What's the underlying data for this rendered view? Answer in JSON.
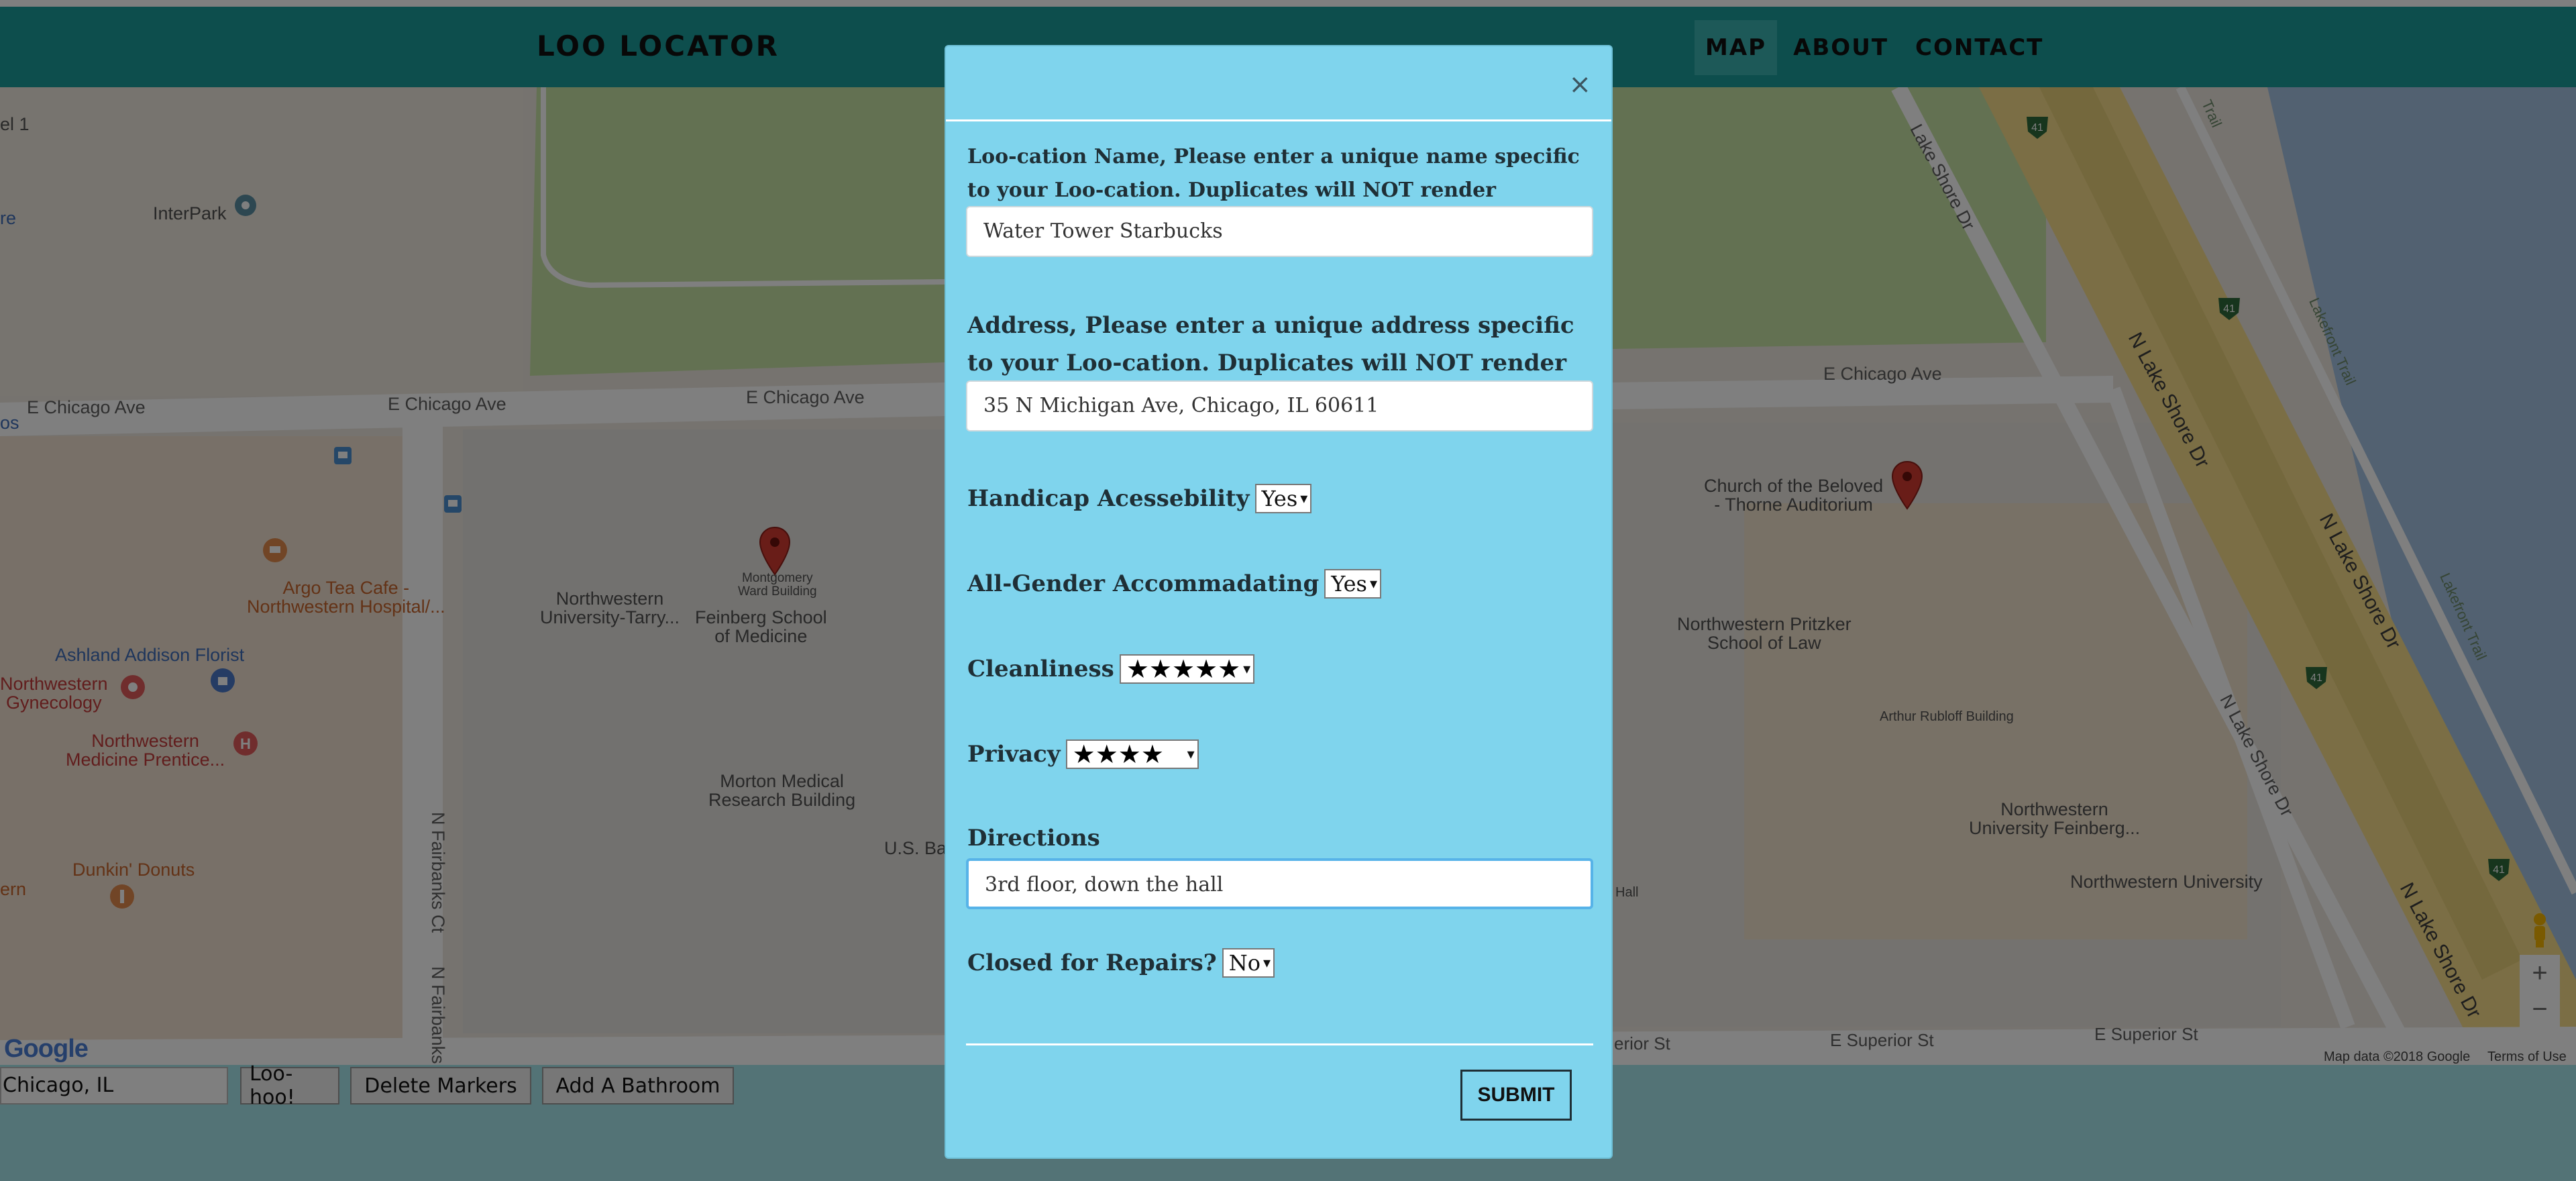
{
  "navbar": {
    "brand": "LOO LOCATOR",
    "links": [
      {
        "label": "MAP",
        "active": true
      },
      {
        "label": "ABOUT",
        "active": false
      },
      {
        "label": "CONTACT",
        "active": false
      }
    ]
  },
  "map": {
    "streets": {
      "e_chicago_1": "E Chicago Ave",
      "e_chicago_2": "E Chicago Ave",
      "e_chicago_3": "E Chicago Ave",
      "e_chicago_4": "E Chicago Ave",
      "n_fairbanks_1": "N Fairbanks Ct",
      "n_fairbanks_2": "N Fairbanks",
      "lake_shore_1": "Lake Shore Dr",
      "n_lake_shore_1": "N Lake Shore Dr",
      "n_lake_shore_2": "N Lake Shore Dr",
      "n_lake_shore_3": "N Lake Shore Dr",
      "n_lake_shore_4": "N Lake Shore Dr",
      "lakefront_1": "Lakefront Trail",
      "lakefront_2": "Lakefront Trail",
      "e_superior_1": "E Superior St",
      "e_superior_2": "E Superior St",
      "superior_partial": "erior St",
      "trail_partial": "Trail",
      "os_partial": "os",
      "el1_partial": "el 1",
      "re_partial": "re",
      "ern_partial": "ern"
    },
    "places": {
      "interpark": "InterPark",
      "argo_tea": "Argo Tea Cafe -\nNorthwestern Hospital/...",
      "ashland_florist": "Ashland Addison Florist",
      "nw_gynecology": "Northwestern\nGynecology",
      "nw_prentice": "Northwestern\nMedicine Prentice...",
      "dunkin": "Dunkin' Donuts",
      "nw_tarry": "Northwestern\nUniversity-Tarry...",
      "montgomery": "Montgomery\nWard Building",
      "feinberg": "Feinberg School\nof Medicine",
      "morton": "Morton Medical\nResearch Building",
      "us_bank": "U.S. Ba",
      "church": "Church of the Beloved\n- Thorne Auditorium",
      "pritzker": "Northwestern Pritzker\nSchool of Law",
      "rubloff": "Arthur Rubloff Building",
      "nw_feinberg2": "Northwestern\nUniversity Feinberg...",
      "nw_university": "Northwestern University",
      "hall": "Hall"
    },
    "route_shield": "41",
    "google_logo": "Google",
    "attribution": "Map data ©2018 Google",
    "terms": "Terms of Use",
    "zoom_in": "+",
    "zoom_out": "−"
  },
  "toolbar": {
    "search_value": "Chicago, IL",
    "loohoo_label": "Loo-hoo!",
    "delete_label": "Delete Markers",
    "add_label": "Add A Bathroom"
  },
  "modal": {
    "close_label": "×",
    "name_label": "Loo-cation Name, Please enter a unique name specific to your Loo-cation. Duplicates will NOT render",
    "name_value": "Water Tower Starbucks",
    "address_label": "Address, Please enter a unique address specific to your Loo-cation. Duplicates will NOT render",
    "address_value": "35 N Michigan Ave, Chicago, IL 60611",
    "handicap_label": "Handicap Acessebility",
    "handicap_value": "Yes",
    "gender_label": "All-Gender Accommadating",
    "gender_value": "Yes",
    "cleanliness_label": "Cleanliness",
    "cleanliness_value": "★★★★★",
    "cleanliness_rating": 5,
    "privacy_label": "Privacy",
    "privacy_value": "★★★★",
    "privacy_rating": 4,
    "directions_label": "Directions",
    "directions_value": "3rd floor, down the hall",
    "closed_label": "Closed for Repairs?",
    "closed_value": "No",
    "submit_label": "SUBMIT",
    "caret": "▾"
  },
  "colors": {
    "navbar": "#1b9c9a",
    "modal_bg": "#7fd4ed",
    "bottom_bar": "#a6e6ec",
    "map_bg": "#ece7df",
    "park": "#c6e3a4",
    "highway": "#f7dc8a",
    "water": "#a4c3e3",
    "marker": "#d23b30"
  }
}
